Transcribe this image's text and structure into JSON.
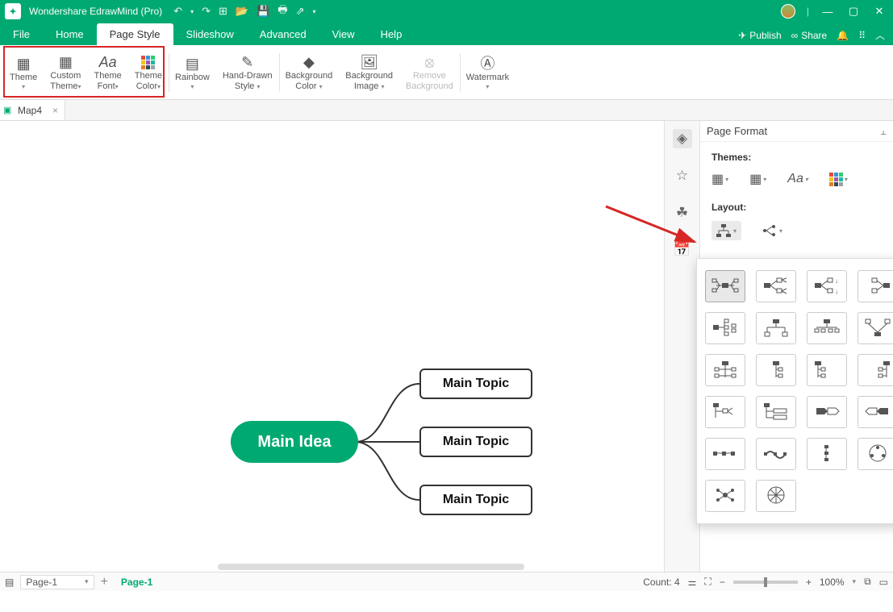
{
  "app": {
    "title": "Wondershare EdrawMind (Pro)"
  },
  "menus": {
    "file": "File",
    "home": "Home",
    "page_style": "Page Style",
    "slideshow": "Slideshow",
    "advanced": "Advanced",
    "view": "View",
    "help": "Help",
    "publish": "Publish",
    "share": "Share"
  },
  "ribbon": {
    "theme": "Theme",
    "custom_theme_l1": "Custom",
    "custom_theme_l2": "Theme",
    "theme_font_l1": "Theme",
    "theme_font_l2": "Font",
    "theme_color_l1": "Theme",
    "theme_color_l2": "Color",
    "rainbow": "Rainbow",
    "hand_drawn_l1": "Hand-Drawn",
    "hand_drawn_l2": "Style",
    "bg_color_l1": "Background",
    "bg_color_l2": "Color",
    "bg_image_l1": "Background",
    "bg_image_l2": "Image",
    "remove_bg_l1": "Remove",
    "remove_bg_l2": "Background",
    "watermark": "Watermark"
  },
  "tab": {
    "name": "Map4"
  },
  "mind": {
    "root": "Main Idea",
    "topic1": "Main Topic",
    "topic2": "Main Topic",
    "topic3": "Main Topic"
  },
  "panel": {
    "title": "Page Format",
    "themes": "Themes:",
    "layout": "Layout:"
  },
  "status": {
    "page_sel": "Page-1",
    "page_tab": "Page-1",
    "count": "Count: 4",
    "zoom": "100%"
  }
}
